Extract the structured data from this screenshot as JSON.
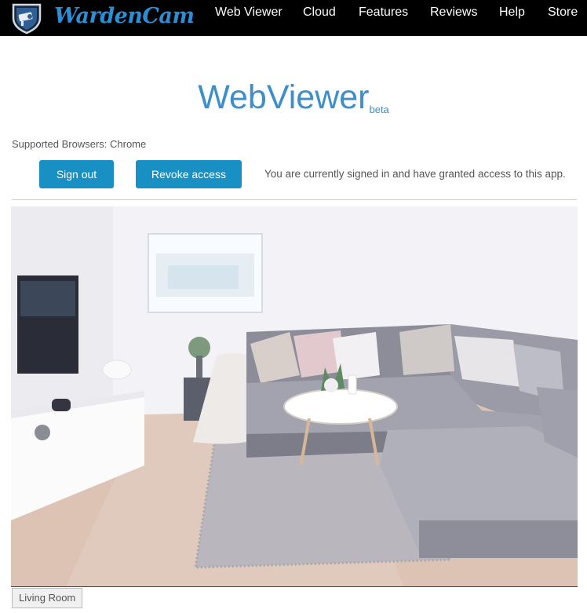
{
  "header": {
    "brand": "WardenCam",
    "nav": [
      {
        "label": "Web Viewer"
      },
      {
        "label": "Cloud"
      },
      {
        "label": "Features"
      },
      {
        "label": "Reviews"
      },
      {
        "label": "Help"
      },
      {
        "label": "Store"
      }
    ]
  },
  "main": {
    "title": "WebViewer",
    "title_suffix": "beta",
    "supported_browsers": "Supported Browsers: Chrome",
    "sign_out_label": "Sign out",
    "revoke_label": "Revoke access",
    "status_text": "You are currently signed in and have granted access to this app."
  },
  "camera": {
    "label": "Living Room"
  },
  "colors": {
    "accent": "#3d8ec9",
    "button": "#1890c4",
    "header_bg": "#000000",
    "brand": "#2b8fd6"
  }
}
